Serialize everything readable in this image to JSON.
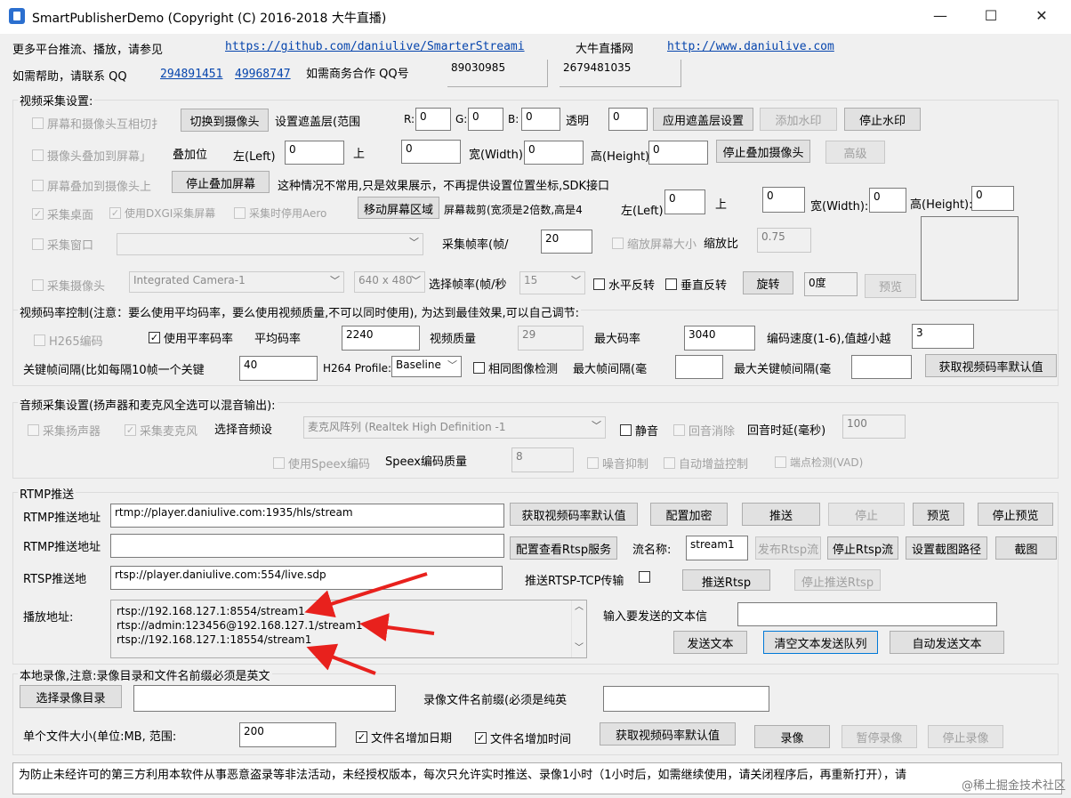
{
  "window": {
    "title": "SmartPublisherDemo  (Copyright (C) 2016-2018 大牛直播)",
    "minimize": "—",
    "maximize": "☐",
    "close": "✕"
  },
  "top": {
    "more_platform": "更多平台推流、播放，请参见",
    "github_url": "https://github.com/daniulive/SmarterStreami",
    "site_label": "大牛直播网",
    "site_url": "http://www.daniulive.com",
    "help_label": "如需帮助，请联系 QQ",
    "qq1": "294891451",
    "qq2": "49968747",
    "biz_label": "如需商务合作 QQ号",
    "biz_qq1": "89030985",
    "biz_qq2": "2679481035"
  },
  "video": {
    "group_label": "视频采集设置:",
    "screen_cam_switch": "屏幕和摄像头互相切扌",
    "switch_to_cam": "切换到摄像头",
    "set_overlay_range": "设置遮盖层(范围",
    "r_label": "R:",
    "r_val": "0",
    "g_label": "G:",
    "g_val": "0",
    "b_label": "B:",
    "b_val": "0",
    "alpha_label": "透明",
    "alpha_val": "0",
    "apply_overlay": "应用遮盖层设置",
    "add_watermark": "添加水印",
    "stop_watermark": "停止水印",
    "cam_overlay_screen": "摄像头叠加到屏幕」",
    "overlay_pos": "叠加位",
    "left_label": "左(Left)",
    "left_val": "0",
    "top_label": "上",
    "top_val": "0",
    "width_label": "宽(Width)",
    "width_val": "0",
    "height_label": "高(Height)",
    "height_val": "0",
    "stop_overlay_cam": "停止叠加摄像头",
    "advanced": "高级",
    "screen_overlay_cam": "屏幕叠加到摄像头上",
    "stop_overlay_screen": "停止叠加屏幕",
    "uncommon_note": "这种情况不常用,只是效果展示，不再提供设置位置坐标,SDK接口",
    "capture_desktop": "采集桌面",
    "use_dxgi": "使用DXGI采集屏幕",
    "disable_aero": "采集时停用Aero",
    "move_screen_area": "移动屏幕区域",
    "screen_crop": "屏幕裁剪(宽须是2倍数,高是4",
    "crop_left_label": "左(Left):",
    "crop_left_val": "0",
    "crop_top_label": "上",
    "crop_top_val": "0",
    "crop_width_label": "宽(Width):",
    "crop_width_val": "0",
    "crop_height_label": "高(Height):",
    "crop_height_val": "0",
    "capture_window": "采集窗口",
    "window_combo": "",
    "fps_label": "采集帧率(帧/",
    "fps_val": "20",
    "scale_screen": "缩放屏幕大小",
    "scale_ratio": "缩放比",
    "scale_val": "0.75",
    "capture_camera": "采集摄像头",
    "camera_combo": "Integrated Camera-1",
    "resolution_combo": "640 x 480",
    "select_fps_label": "选择帧率(帧/秒",
    "cam_fps_combo": "15",
    "hflip": "水平反转",
    "vflip": "垂直反转",
    "rotate": "旋转",
    "rotate_val": "0度",
    "preview": "预览"
  },
  "bitrate": {
    "note": "视频码率控制(注意：要么使用平均码率，要么使用视频质量,不可以同时使用), 为达到最佳效果,可以自己调节:",
    "h265": "H265编码",
    "use_avg": "使用平率码率",
    "avg_label": "平均码率",
    "avg_val": "2240",
    "quality_label": "视频质量",
    "quality_val": "29",
    "max_label": "最大码率",
    "max_val": "3040",
    "speed_label": "编码速度(1-6),值越小越",
    "speed_val": "3",
    "keyframe_label": "关键帧间隔(比如每隔10帧一个关键",
    "keyframe_val": "40",
    "profile_label": "H264 Profile:",
    "profile_val": "Baseline",
    "same_img": "相同图像检测",
    "max_frame_interval": "最大帧间隔(毫",
    "max_frame_interval_val": "",
    "max_key_interval": "最大关键帧间隔(毫",
    "max_key_interval_val": "",
    "get_default": "获取视频码率默认值"
  },
  "audio": {
    "group_label": "音频采集设置(扬声器和麦克风全选可以混音输出):",
    "speaker": "采集扬声器",
    "mic": "采集麦克风",
    "select_device": "选择音频设",
    "device_combo": "麦克风阵列 (Realtek High Definition -1",
    "mute": "静音",
    "echo_cancel": "回音消除",
    "echo_delay": "回音时延(毫秒)",
    "echo_delay_val": "100",
    "use_speex": "使用Speex编码",
    "speex_quality": "Speex编码质量",
    "speex_val": "8",
    "noise_suppress": "噪音抑制",
    "agc": "自动增益控制",
    "vad": "端点检测(VAD)"
  },
  "rtmp": {
    "group_label": "RTMP推送",
    "url_label": "RTMP推送地址",
    "url_val": "rtmp://player.daniulive.com:1935/hls/stream",
    "get_default": "获取视频码率默认值",
    "config_encrypt": "配置加密",
    "push": "推送",
    "stop": "停止",
    "preview": "预览",
    "stop_preview": "停止预览",
    "url2_label": "RTMP推送地址",
    "url2_val": "",
    "config_rtsp": "配置查看Rtsp服务",
    "stream_name_label": "流名称:",
    "stream_name_val": "stream1",
    "publish_rtsp": "发布Rtsp流",
    "stop_rtsp": "停止Rtsp流",
    "set_snapshot_path": "设置截图路径",
    "snapshot": "截图",
    "rtsp_label": "RTSP推送地",
    "rtsp_val": "rtsp://player.daniulive.com:554/live.sdp",
    "rtsp_tcp": "推送RTSP-TCP传输",
    "push_rtsp": "推送Rtsp",
    "stop_push_rtsp": "停止推送Rtsp",
    "play_label": "播放地址:",
    "play_urls": [
      "rtsp://192.168.127.1:8554/stream1",
      "rtsp://admin:123456@192.168.127.1/stream1",
      "rtsp://192.168.127.1:18554/stream1"
    ],
    "text_input_label": "输入要发送的文本信",
    "text_input_val": "",
    "send_text": "发送文本",
    "clear_queue": "清空文本发送队列",
    "auto_send": "自动发送文本"
  },
  "record": {
    "group_label": "本地录像,注意:录像目录和文件名前缀必须是英文",
    "select_dir": "选择录像目录",
    "dir_val": "",
    "prefix_label": "录像文件名前缀(必须是纯英",
    "prefix_val": "",
    "file_size_label": "单个文件大小(单位:MB, 范围:",
    "file_size_val": "200",
    "add_date": "文件名增加日期",
    "add_time": "文件名增加时间",
    "get_default": "获取视频码率默认值",
    "record": "录像",
    "pause": "暂停录像",
    "stop": "停止录像"
  },
  "status": {
    "text": "为防止未经许可的第三方利用本软件从事恶意盗录等非法活动，未经授权版本，每次只允许实时推送、录像1小时（1小时后，如需继续使用，请关闭程序后，再重新打开），请"
  },
  "watermark": "@稀土掘金技术社区",
  "colors": {
    "arrow": "#e8211d",
    "link": "#0645ad",
    "focus": "#0078d7"
  }
}
